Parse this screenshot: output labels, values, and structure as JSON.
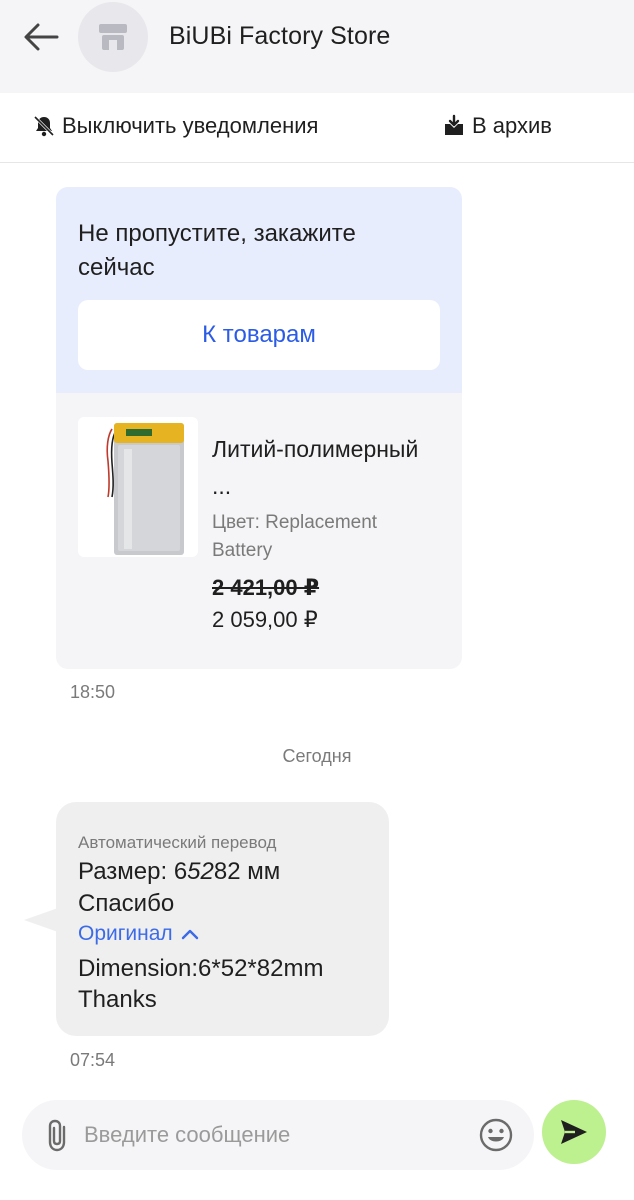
{
  "header": {
    "back_icon": "arrow-left-icon",
    "avatar_icon": "store-icon",
    "title": "BiUBi Factory Store"
  },
  "actions": {
    "mute_icon": "bell-off-icon",
    "mute_label": "Выключить уведомления",
    "archive_icon": "archive-icon",
    "archive_label": "В архив"
  },
  "promo": {
    "text": "Не пропустите, закажите сейчас",
    "button_label": "К товарам",
    "product": {
      "image_icon": "battery-image",
      "name": "Литий-полимерный ...",
      "color": "Цвет: Replacement Battery",
      "old_price": "2 421,00 ₽",
      "new_price": "2 059,00 ₽"
    },
    "time": "18:50"
  },
  "date_separator": "Сегодня",
  "message": {
    "auto_label": "Автоматический перевод",
    "translated_line1": "Размер: 6",
    "translated_italic": "52",
    "translated_line1_end": "82 мм",
    "translated_line2": "Спасибо",
    "original_toggle": "Оригинал",
    "original_line1": "Dimension:6*52*82mm",
    "original_line2": "Thanks",
    "time": "07:54"
  },
  "composer": {
    "placeholder": "Введите сообщение",
    "attach_icon": "paperclip-icon",
    "emoji_icon": "smile-icon",
    "send_icon": "send-icon"
  },
  "colors": {
    "accent_blue": "#2c5ce6",
    "promo_bg": "#e8edfd",
    "send_green": "#bdf08e"
  }
}
